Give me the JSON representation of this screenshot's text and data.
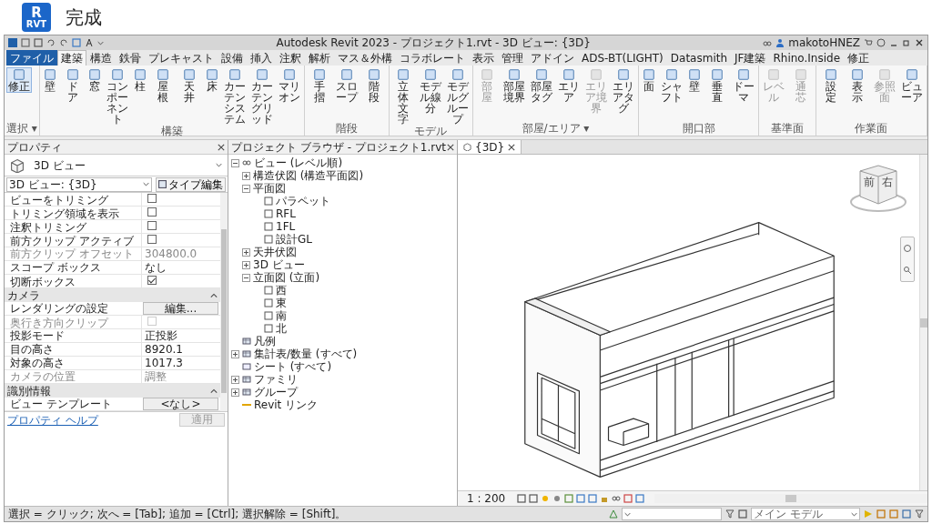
{
  "slide": {
    "logo_letter": "R",
    "logo_caption": "RVT",
    "heading": "完成"
  },
  "app": {
    "title": "Autodesk Revit 2023 - プロジェクト1.rvt - 3D ビュー: {3D}",
    "user": "makotoHNEZ",
    "tabs": [
      {
        "label": "ファイル",
        "kind": "file",
        "selected": false
      },
      {
        "label": "建築",
        "kind": "tab",
        "selected": true
      },
      {
        "label": "構造",
        "kind": "tab",
        "selected": false
      },
      {
        "label": "鉄骨",
        "kind": "tab",
        "selected": false
      },
      {
        "label": "プレキャスト",
        "kind": "tab",
        "selected": false
      },
      {
        "label": "設備",
        "kind": "tab",
        "selected": false
      },
      {
        "label": "挿入",
        "kind": "tab",
        "selected": false
      },
      {
        "label": "注釈",
        "kind": "tab",
        "selected": false
      },
      {
        "label": "解析",
        "kind": "tab",
        "selected": false
      },
      {
        "label": "マス＆外構",
        "kind": "tab",
        "selected": false
      },
      {
        "label": "コラボレート",
        "kind": "tab",
        "selected": false
      },
      {
        "label": "表示",
        "kind": "tab",
        "selected": false
      },
      {
        "label": "管理",
        "kind": "tab",
        "selected": false
      },
      {
        "label": "アドイン",
        "kind": "tab",
        "selected": false
      },
      {
        "label": "ADS-BT(LIGHT)",
        "kind": "tab",
        "selected": false
      },
      {
        "label": "Datasmith",
        "kind": "tab",
        "selected": false
      },
      {
        "label": "JF建築",
        "kind": "tab",
        "selected": false
      },
      {
        "label": "Rhino.Inside",
        "kind": "tab",
        "selected": false
      },
      {
        "label": "修正",
        "kind": "tab",
        "selected": false
      }
    ],
    "ribbon": [
      {
        "title": "選択 ▾",
        "tools": [
          {
            "label": "修正",
            "disabled": false
          }
        ]
      },
      {
        "title": "構築",
        "tools": [
          {
            "label": "壁",
            "disabled": false
          },
          {
            "label": "ドア",
            "disabled": false
          },
          {
            "label": "窓",
            "disabled": false
          },
          {
            "label": "コンポーネント",
            "disabled": false
          },
          {
            "label": "柱",
            "disabled": false
          },
          {
            "label": "屋根",
            "disabled": false
          },
          {
            "label": "天井",
            "disabled": false
          },
          {
            "label": "床",
            "disabled": false
          },
          {
            "label": "カーテンシステム",
            "disabled": false
          },
          {
            "label": "カーテングリッド",
            "disabled": false
          },
          {
            "label": "マリオン",
            "disabled": false
          }
        ]
      },
      {
        "title": "階段",
        "tools": [
          {
            "label": "手摺",
            "disabled": false
          },
          {
            "label": "スロープ",
            "disabled": false
          },
          {
            "label": "階段",
            "disabled": false
          }
        ]
      },
      {
        "title": "モデル",
        "tools": [
          {
            "label": "立体文字",
            "disabled": false
          },
          {
            "label": "モデル線分",
            "disabled": false
          },
          {
            "label": "モデルグループ",
            "disabled": false
          }
        ]
      },
      {
        "title": "部屋/エリア ▾",
        "tools": [
          {
            "label": "部屋",
            "disabled": true
          },
          {
            "label": "部屋境界",
            "disabled": false
          },
          {
            "label": "部屋タグ",
            "disabled": false
          },
          {
            "label": "エリア",
            "disabled": false
          },
          {
            "label": "エリア境界",
            "disabled": true
          },
          {
            "label": "エリアタグ",
            "disabled": false
          }
        ]
      },
      {
        "title": "開口部",
        "tools": [
          {
            "label": "面",
            "disabled": false
          },
          {
            "label": "シャフト",
            "disabled": false
          },
          {
            "label": "壁",
            "disabled": false
          },
          {
            "label": "垂直",
            "disabled": false
          },
          {
            "label": "ドーマ",
            "disabled": false
          }
        ]
      },
      {
        "title": "基準面",
        "tools": [
          {
            "label": "レベル",
            "disabled": true
          },
          {
            "label": "通芯",
            "disabled": true
          }
        ]
      },
      {
        "title": "作業面",
        "tools": [
          {
            "label": "設定",
            "disabled": false
          },
          {
            "label": "表示",
            "disabled": false
          },
          {
            "label": "参照面",
            "disabled": true
          },
          {
            "label": "ビューア",
            "disabled": false
          }
        ]
      }
    ],
    "properties": {
      "title": "プロパティ",
      "type_name": "3D ビュー",
      "instance": "3D ビュー: {3D}",
      "edit_type": "タイプ編集",
      "rows": [
        {
          "kind": "checkbox",
          "label": "ビューをトリミング",
          "checked": false,
          "disabled": false
        },
        {
          "kind": "checkbox",
          "label": "トリミング領域を表示",
          "checked": false,
          "disabled": false
        },
        {
          "kind": "checkbox",
          "label": "注釈トリミング",
          "checked": false,
          "disabled": false
        },
        {
          "kind": "checkbox",
          "label": "前方クリップ アクティブ",
          "checked": false,
          "disabled": false
        },
        {
          "kind": "text",
          "label": "前方クリップ オフセット",
          "value": "304800.0",
          "disabled": true
        },
        {
          "kind": "text",
          "label": "スコープ ボックス",
          "value": "なし",
          "disabled": false
        },
        {
          "kind": "checkbox",
          "label": "切断ボックス",
          "checked": true,
          "disabled": false
        },
        {
          "kind": "group",
          "label": "カメラ",
          "expanded": true
        },
        {
          "kind": "button",
          "label": "レンダリングの設定",
          "value": "編集...",
          "disabled": false
        },
        {
          "kind": "checkbox",
          "label": "奥行き方向クリップ",
          "checked": false,
          "disabled": true
        },
        {
          "kind": "text",
          "label": "投影モード",
          "value": "正投影",
          "disabled": false
        },
        {
          "kind": "text",
          "label": "目の高さ",
          "value": "8920.1",
          "disabled": false
        },
        {
          "kind": "text",
          "label": "対象の高さ",
          "value": "1017.3",
          "disabled": false
        },
        {
          "kind": "text",
          "label": "カメラの位置",
          "value": "調整",
          "disabled": true
        },
        {
          "kind": "group",
          "label": "識別情報",
          "expanded": true
        },
        {
          "kind": "button",
          "label": "ビュー テンプレート",
          "value": "<なし>",
          "disabled": false
        }
      ],
      "help": "プロパティ ヘルプ",
      "apply": {
        "label": "適用",
        "disabled": true
      }
    },
    "browser": {
      "title": "プロジェクト ブラウザ - プロジェクト1.rvt",
      "tree": [
        {
          "label": "ビュー (レベル順)",
          "kind": "root",
          "expanded": true,
          "children": [
            {
              "label": "構造伏図 (構造平面図)",
              "expanded": false
            },
            {
              "label": "平面図",
              "expanded": true,
              "children": [
                {
                  "label": "パラペット",
                  "kind": "view"
                },
                {
                  "label": "RFL",
                  "kind": "view"
                },
                {
                  "label": "1FL",
                  "kind": "view"
                },
                {
                  "label": "設計GL",
                  "kind": "view"
                }
              ]
            },
            {
              "label": "天井伏図",
              "expanded": false
            },
            {
              "label": "3D ビュー",
              "expanded": false
            },
            {
              "label": "立面図 (立面)",
              "expanded": true,
              "children": [
                {
                  "label": "西",
                  "kind": "view"
                },
                {
                  "label": "東",
                  "kind": "view"
                },
                {
                  "label": "南",
                  "kind": "view"
                },
                {
                  "label": "北",
                  "kind": "view"
                }
              ]
            }
          ]
        },
        {
          "label": "凡例",
          "kind": "table"
        },
        {
          "label": "集計表/数量 (すべて)",
          "kind": "table",
          "expanded": false
        },
        {
          "label": "シート (すべて)",
          "kind": "sheet"
        },
        {
          "label": "ファミリ",
          "kind": "table",
          "expanded": false
        },
        {
          "label": "グループ",
          "kind": "table",
          "expanded": false
        },
        {
          "label": "Revit リンク",
          "kind": "link"
        }
      ]
    },
    "view": {
      "tab": "{3D}",
      "cube_front": "前",
      "cube_right": "右",
      "scale": "1 : 200"
    },
    "status": {
      "hint": "選択 = クリック; 次へ = [Tab]; 追加 = [Ctrl]; 選択解除 = [Shift]。",
      "model": "メイン モデル"
    }
  }
}
